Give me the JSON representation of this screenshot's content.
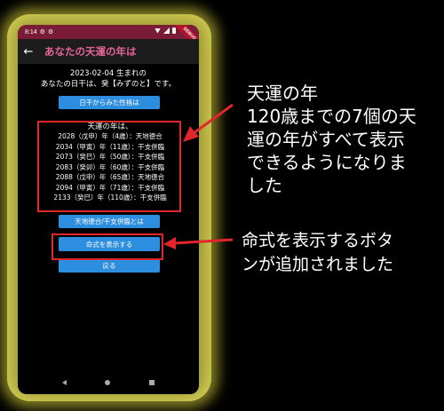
{
  "statusbar": {
    "time": "8:14",
    "icon1": "⚙",
    "icon2": "⚙"
  },
  "debug_banner": "DEBUG",
  "appbar": {
    "back_icon": "←",
    "title": "あなたの天運の年は"
  },
  "birth_line": "2023-02-04 生まれの",
  "daykan_line": "あなたの日干は、癸【みずのと】です。",
  "buttons": {
    "personality": "日干からみた性格は",
    "tenchi": "天地徳合/干支併臨とは",
    "meishiki": "命式を表示する",
    "back": "戻る"
  },
  "luck": {
    "title": "天運の年は、",
    "rows": [
      "2028（戊申）年（4歳）：天地徳合",
      "2034（甲寅）年（11歳）：干支併臨",
      "2073（癸巳）年（50歳）：干支併臨",
      "2083（癸卯）年（60歳）：干支併臨",
      "2088（戊申）年（65歳）：天地徳合",
      "2094（甲寅）年（71歳）：干支併臨",
      "2133（癸巳）年（110歳）：干支併臨"
    ]
  },
  "annotations": {
    "note1_line1": "天運の年",
    "note1_line2": "120歳までの7個の天",
    "note1_line3": "運の年がすべて表示",
    "note1_line4": "できるようになりま",
    "note1_line5": "した",
    "note2_line1": "命式を表示するボタ",
    "note2_line2": "ンが追加されました"
  },
  "colors": {
    "accent_pink": "#e6639a",
    "button_blue": "#2d8ee0",
    "annotation_red": "#e0262a",
    "statusbar": "#7b1c36"
  }
}
